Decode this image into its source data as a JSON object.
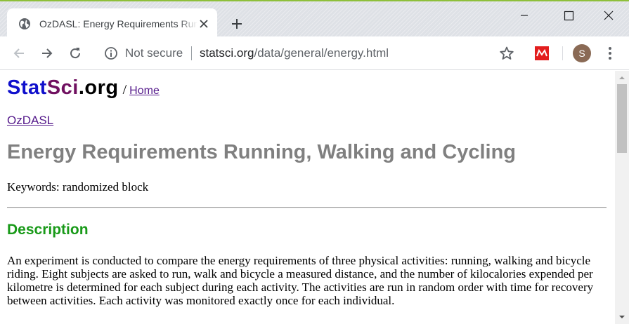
{
  "browser": {
    "tab": {
      "title": "OzDASL: Energy Requirements Running, Walking and Cycling",
      "favicon": "globe-icon"
    },
    "new_tab_label": "+",
    "window_controls": [
      "minimize-icon",
      "maximize-icon",
      "close-icon"
    ],
    "address_bar": {
      "security_label": "Not secure",
      "url_host": "statsci.org",
      "url_path": "/data/general/energy.html"
    },
    "profile_initial": "S",
    "colors": {
      "tabstrip": "#dee1e6",
      "accent_line": "#8ebf3a",
      "extension_red": "#e31e1e",
      "avatar": "#8a6a55"
    }
  },
  "page": {
    "logo": {
      "part1": "Stat",
      "part2": "Sci",
      "part3": ".org",
      "colors": [
        "#1010cc",
        "#701060",
        "#000000"
      ]
    },
    "breadcrumb_separator": "/",
    "breadcrumb_home": "Home",
    "ozdasl_link": "OzDASL",
    "title": "Energy Requirements Running, Walking and Cycling",
    "keywords": "Keywords: randomized block",
    "description_heading": "Description",
    "description_text": "An experiment is conducted to compare the energy requirements of three physical activities: running, walking and bicycle riding. Eight subjects are asked to run, walk and bicycle a measured distance, and the number of kilocalories expended per kilometre is determined for each subject during each activity. The activities are run in random order with time for recovery between activities. Each activity was monitored exactly once for each individual.",
    "colors": {
      "title": "#808080",
      "heading": "#199a19",
      "link": "#551a8b"
    }
  }
}
